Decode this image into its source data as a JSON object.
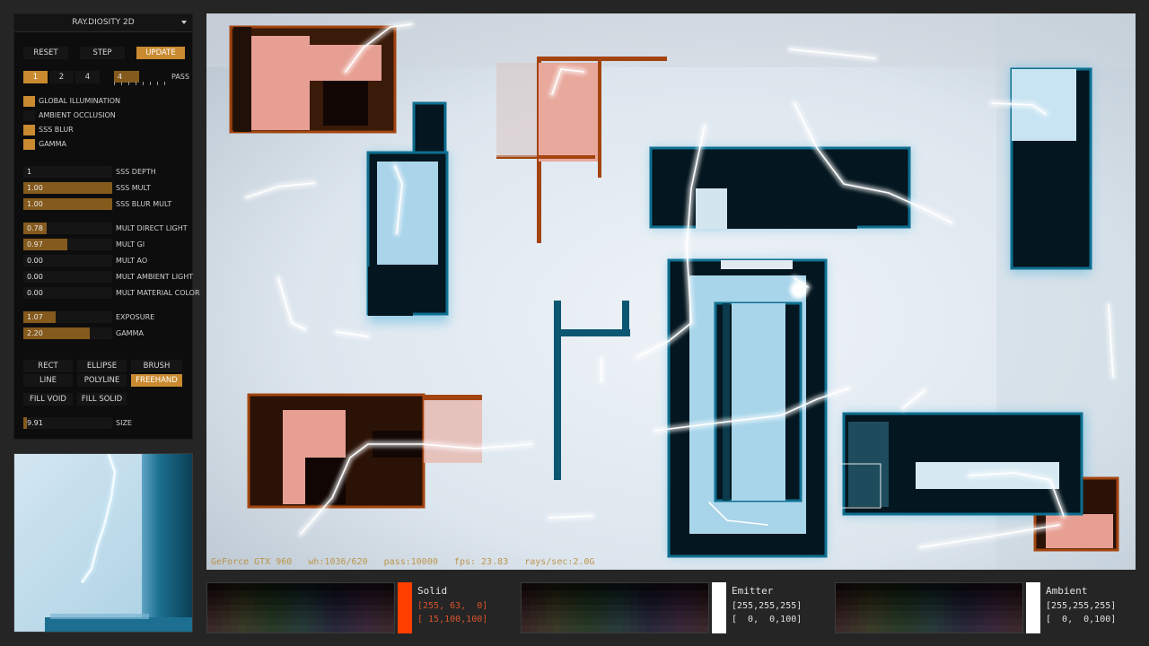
{
  "panel": {
    "title": "RAY.DIOSITY 2D",
    "buttons": [
      "RESET",
      "STEP",
      "UPDATE"
    ],
    "pass_buttons": [
      "1",
      "2",
      "4"
    ],
    "pass_value": "4",
    "pass_label": "PASS",
    "pass_level": 0.45,
    "toggles": [
      {
        "label": "GLOBAL ILLUMINATION",
        "on": true
      },
      {
        "label": "AMBIENT OCCLUSION",
        "on": false
      },
      {
        "label": "SSS BLUR",
        "on": true
      },
      {
        "label": "GAMMA",
        "on": true
      }
    ],
    "sliders_a": [
      {
        "value": "1",
        "label": "SSS DEPTH",
        "fill": 0.0
      },
      {
        "value": "1.00",
        "label": "SSS MULT",
        "fill": 1.0
      },
      {
        "value": "1.00",
        "label": "SSS BLUR MULT",
        "fill": 1.0
      }
    ],
    "sliders_b": [
      {
        "value": "0.78",
        "label": "MULT DIRECT LIGHT",
        "fill": 0.26
      },
      {
        "value": "0.97",
        "label": "MULT GI",
        "fill": 0.49
      },
      {
        "value": "0.00",
        "label": "MULT AO",
        "fill": 0.0
      },
      {
        "value": "0.00",
        "label": "MULT AMBIENT LIGHT",
        "fill": 0.0
      },
      {
        "value": "0.00",
        "label": "MULT MATERIAL COLOR",
        "fill": 0.0
      }
    ],
    "sliders_c": [
      {
        "value": "1.07",
        "label": "EXPOSURE",
        "fill": 0.36
      },
      {
        "value": "2.20",
        "label": "GAMMA",
        "fill": 0.75
      }
    ],
    "shapes": [
      "RECT",
      "ELLIPSE",
      "BRUSH",
      "LINE",
      "POLYLINE",
      "FREEHAND"
    ],
    "active_shape": "FREEHAND",
    "fills": [
      "FILL VOID",
      "FILL SOLID"
    ],
    "size": {
      "value": "9.91",
      "label": "SIZE",
      "fill": 0.04
    }
  },
  "canvas": {
    "stats": "GeForce GTX 960   wh:1036/620   pass:10000   fps: 23.83   rays/sec:2.0G"
  },
  "materials": [
    {
      "name": "Solid",
      "line1": "[255, 63,  0]",
      "line2": "[ 15,100,100]",
      "swatch": "#ff3f00"
    },
    {
      "name": "Emitter",
      "line1": "[255,255,255]",
      "line2": "[  0,  0,100]",
      "swatch": "#ffffff"
    },
    {
      "name": "Ambient",
      "line1": "[255,255,255]",
      "line2": "[  0,  0,100]",
      "swatch": "#ffffff"
    }
  ],
  "colors": {
    "accent": "#c98a30",
    "solid": "#ff3f00",
    "wall_blue": "#0e5d78",
    "wall_orange": "#a3440f"
  }
}
